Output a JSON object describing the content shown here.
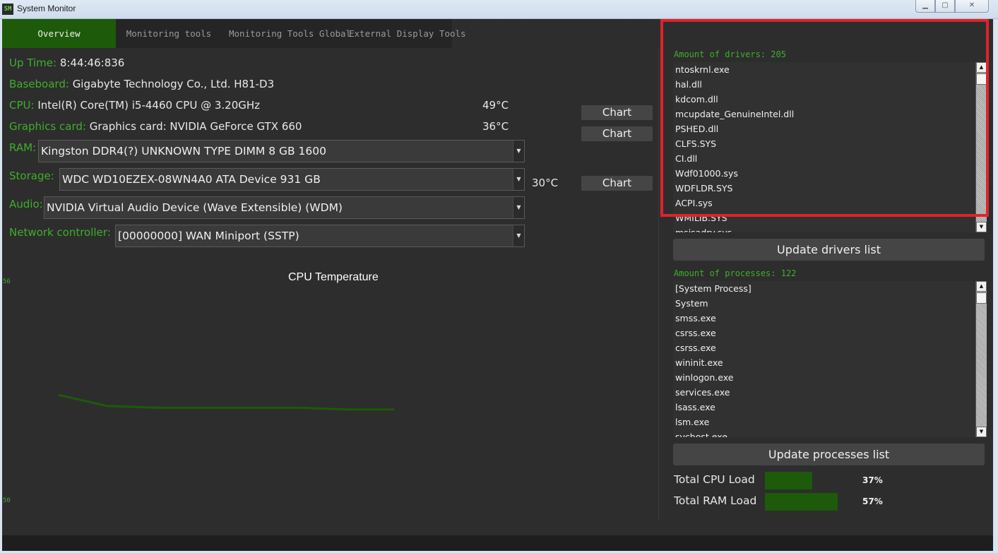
{
  "window": {
    "icon_text": "SM",
    "title": "System Monitor",
    "controls": {
      "minimize": "▁",
      "maximize": "▢",
      "close": "✕"
    }
  },
  "tabs": [
    {
      "label": "Overview",
      "active": true
    },
    {
      "label": "Monitoring tools",
      "active": false
    },
    {
      "label": "Monitoring Tools Global",
      "active": false
    },
    {
      "label": "External Display Tools",
      "active": false
    }
  ],
  "overview": {
    "uptime": {
      "label": "Up Time:",
      "value": "8:44:46:836"
    },
    "baseboard": {
      "label": "Baseboard:",
      "value": "Gigabyte Technology Co., Ltd. H81-D3"
    },
    "cpu": {
      "label": "CPU:",
      "value": "Intel(R) Core(TM) i5-4460  CPU @ 3.20GHz",
      "temp": "49°C",
      "chart_button": "Chart"
    },
    "gpu": {
      "label": "Graphics card:",
      "value": "Graphics card: NVIDIA GeForce GTX 660",
      "temp": "36°C",
      "chart_button": "Chart"
    },
    "ram": {
      "label": "RAM:",
      "selected": "Kingston DDR4(?) UNKNOWN TYPE DIMM 8 GB 1600"
    },
    "storage": {
      "label": "Storage:",
      "selected": "WDC WD10EZEX-08WN4A0 ATA Device 931 GB",
      "temp": "30°C",
      "chart_button": "Chart"
    },
    "audio": {
      "label": "Audio:",
      "selected": "NVIDIA Virtual Audio Device (Wave Extensible) (WDM)"
    },
    "network": {
      "label": "Network controller:",
      "selected": "[00000000] WAN Miniport (SSTP)"
    },
    "dropdown_arrow": "▼"
  },
  "chart_data": {
    "type": "line",
    "title": "CPU Temperature",
    "ylim": [
      50,
      56
    ],
    "y_ticks": [
      "56",
      "50"
    ],
    "series": [
      {
        "values": [
          52.9,
          52.6,
          52.55,
          52.55,
          52.55,
          52.55,
          52.5,
          52.5
        ]
      }
    ],
    "line_color": "#1d5a0a",
    "grid": false
  },
  "drivers": {
    "count_label": "Amount of drivers: 205",
    "items": [
      "ntoskrnl.exe",
      "hal.dll",
      "kdcom.dll",
      "mcupdate_GenuineIntel.dll",
      "PSHED.dll",
      "CLFS.SYS",
      "CI.dll",
      "Wdf01000.sys",
      "WDFLDR.SYS",
      "ACPI.sys",
      "WMILIB.SYS",
      "msisadrv.sys"
    ],
    "update_button": "Update drivers list"
  },
  "processes": {
    "count_label": "Amount of processes: 122",
    "items": [
      "[System Process]",
      "System",
      "smss.exe",
      "csrss.exe",
      "csrss.exe",
      "wininit.exe",
      "winlogon.exe",
      "services.exe",
      "lsass.exe",
      "lsm.exe",
      "svchost.exe"
    ],
    "update_button": "Update processes list"
  },
  "scroll": {
    "up": "▲",
    "down": "▼"
  },
  "load": {
    "cpu": {
      "label": "Total CPU Load",
      "percent_text": "37%",
      "value": 0.37
    },
    "ram": {
      "label": "Total RAM Load",
      "percent_text": "57%",
      "value": 0.57
    }
  },
  "colors": {
    "accent": "#3fae2a",
    "active_tab": "#1d5a0a",
    "highlight": "#e0222a",
    "background": "#2d2d2d"
  }
}
